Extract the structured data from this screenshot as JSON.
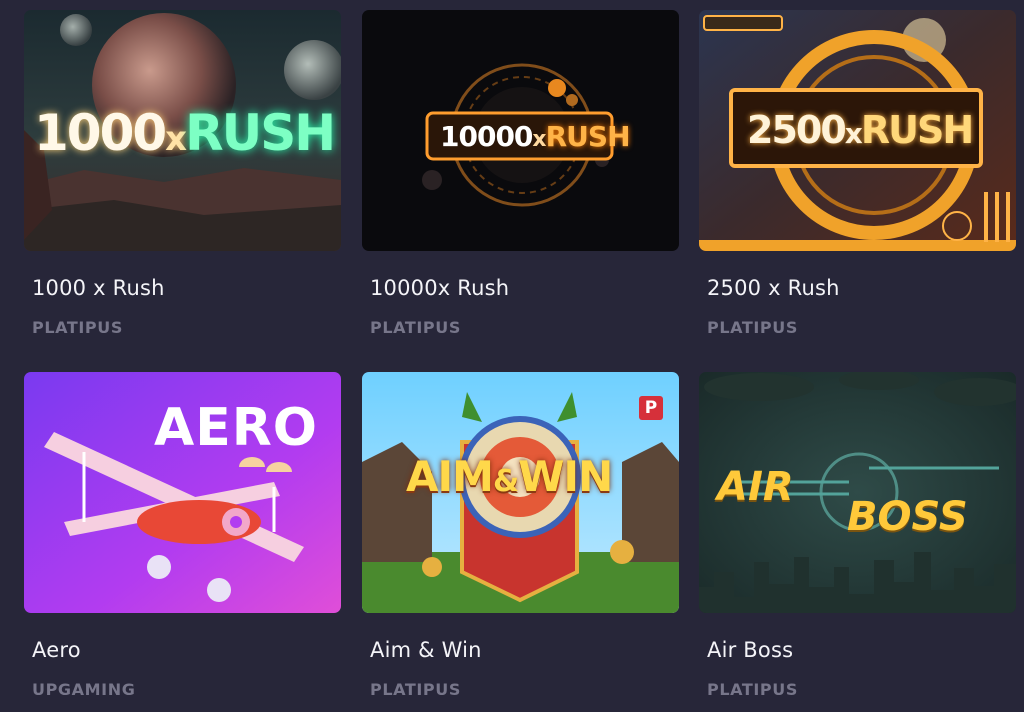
{
  "games": [
    {
      "title": "1000 x Rush",
      "provider": "PLATIPUS",
      "logo": "1000xRUSH",
      "logo_parts": [
        "1000",
        "x",
        "RUSH"
      ]
    },
    {
      "title": "10000x Rush",
      "provider": "PLATIPUS",
      "logo": "10000xRUSH",
      "logo_parts": [
        "10000",
        "x",
        "RUSH"
      ]
    },
    {
      "title": "2500 x Rush",
      "provider": "PLATIPUS",
      "logo": "2500xRUSH",
      "logo_parts": [
        "2500",
        "x",
        "RUSH"
      ]
    },
    {
      "title": "Aero",
      "provider": "UPGAMING",
      "logo": "AERO",
      "logo_parts": [
        "AERO"
      ]
    },
    {
      "title": "Aim & Win",
      "provider": "PLATIPUS",
      "logo": "AIM&WIN",
      "logo_parts": [
        "AIM",
        "&",
        "WIN"
      ],
      "badge": "P"
    },
    {
      "title": "Air Boss",
      "provider": "PLATIPUS",
      "logo": "AIR BOSS",
      "logo_parts": [
        "AIR",
        "BOSS"
      ]
    }
  ],
  "colors": {
    "page_background": "#272639",
    "title_text": "#f4f4f8",
    "provider_text": "#77768a",
    "rush_green": "#7dffc4",
    "rush_orange": "#ffb347",
    "aero_purple": "#b23cf0",
    "airboss_gold": "#ffc93a"
  }
}
